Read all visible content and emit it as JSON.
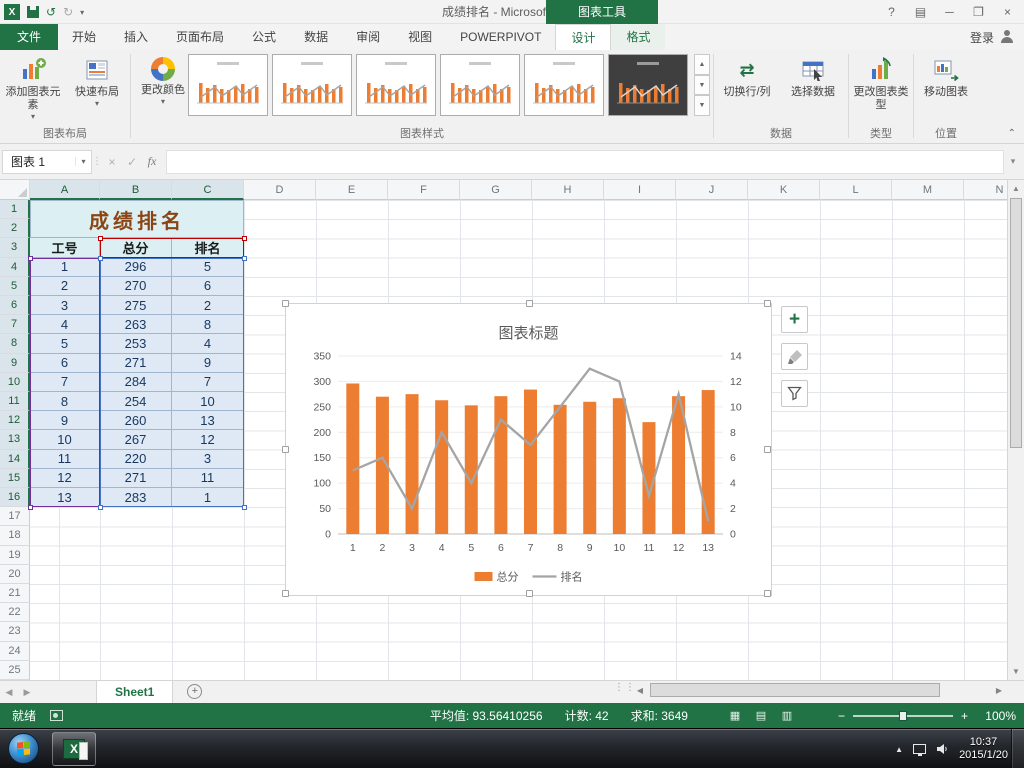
{
  "window": {
    "title": "成绩排名 - Microsoft Excel",
    "context_title": "图表工具",
    "help": "?",
    "sign_in": "登录"
  },
  "tabs": {
    "file": "文件",
    "items": [
      "开始",
      "插入",
      "页面布局",
      "公式",
      "数据",
      "审阅",
      "视图",
      "POWERPIVOT"
    ],
    "contextual": [
      "设计",
      "格式"
    ],
    "active": "设计"
  },
  "ribbon": {
    "add_chart_element": "添加图表元素",
    "quick_layout": "快速布局",
    "change_colors": "更改颜色",
    "switch_row_col": "切换行/列",
    "select_data": "选择数据",
    "change_chart_type": "更改图表类型",
    "move_chart": "移动图表",
    "styles_visible": 6,
    "groups": {
      "layout": "图表布局",
      "styles": "图表样式",
      "data": "数据",
      "type": "类型",
      "location": "位置"
    }
  },
  "formula_bar": {
    "name_box": "图表 1",
    "fx": "fx"
  },
  "sheet": {
    "col_headers": [
      "A",
      "B",
      "C",
      "D",
      "E",
      "F",
      "G",
      "H",
      "I",
      "J",
      "K",
      "L",
      "M",
      "N"
    ],
    "visible_rows": 25,
    "selected_cols": [
      "A",
      "B",
      "C"
    ],
    "selected_rows_through": 16,
    "table": {
      "title": "成绩排名",
      "headers": [
        "工号",
        "总分",
        "排名"
      ],
      "rows": [
        [
          1,
          296,
          5
        ],
        [
          2,
          270,
          6
        ],
        [
          3,
          275,
          2
        ],
        [
          4,
          263,
          8
        ],
        [
          5,
          253,
          4
        ],
        [
          6,
          271,
          9
        ],
        [
          7,
          284,
          7
        ],
        [
          8,
          254,
          10
        ],
        [
          9,
          260,
          13
        ],
        [
          10,
          267,
          12
        ],
        [
          11,
          220,
          3
        ],
        [
          12,
          271,
          11
        ],
        [
          13,
          283,
          1
        ]
      ]
    },
    "tab_name": "Sheet1"
  },
  "chart_data": {
    "type": "combo",
    "title": "图表标题",
    "categories": [
      1,
      2,
      3,
      4,
      5,
      6,
      7,
      8,
      9,
      10,
      11,
      12,
      13
    ],
    "series": [
      {
        "name": "总分",
        "type": "bar",
        "axis": "primary",
        "color": "#ED7D31",
        "values": [
          296,
          270,
          275,
          263,
          253,
          271,
          284,
          254,
          260,
          267,
          220,
          271,
          283
        ]
      },
      {
        "name": "排名",
        "type": "line",
        "axis": "secondary",
        "color": "#A5A5A5",
        "values": [
          5,
          6,
          2,
          8,
          4,
          9,
          7,
          10,
          13,
          12,
          3,
          11,
          1
        ]
      }
    ],
    "primary_axis": {
      "min": 0,
      "max": 350,
      "step": 50
    },
    "secondary_axis": {
      "min": 0,
      "max": 14,
      "step": 2
    },
    "legend_position": "bottom",
    "gridlines": true
  },
  "status_bar": {
    "mode": "就绪",
    "average": "平均值: 93.56410256",
    "count": "计数: 42",
    "sum": "求和: 3649",
    "zoom": "100%"
  },
  "taskbar": {
    "time": "10:37",
    "date": "2015/1/20"
  }
}
